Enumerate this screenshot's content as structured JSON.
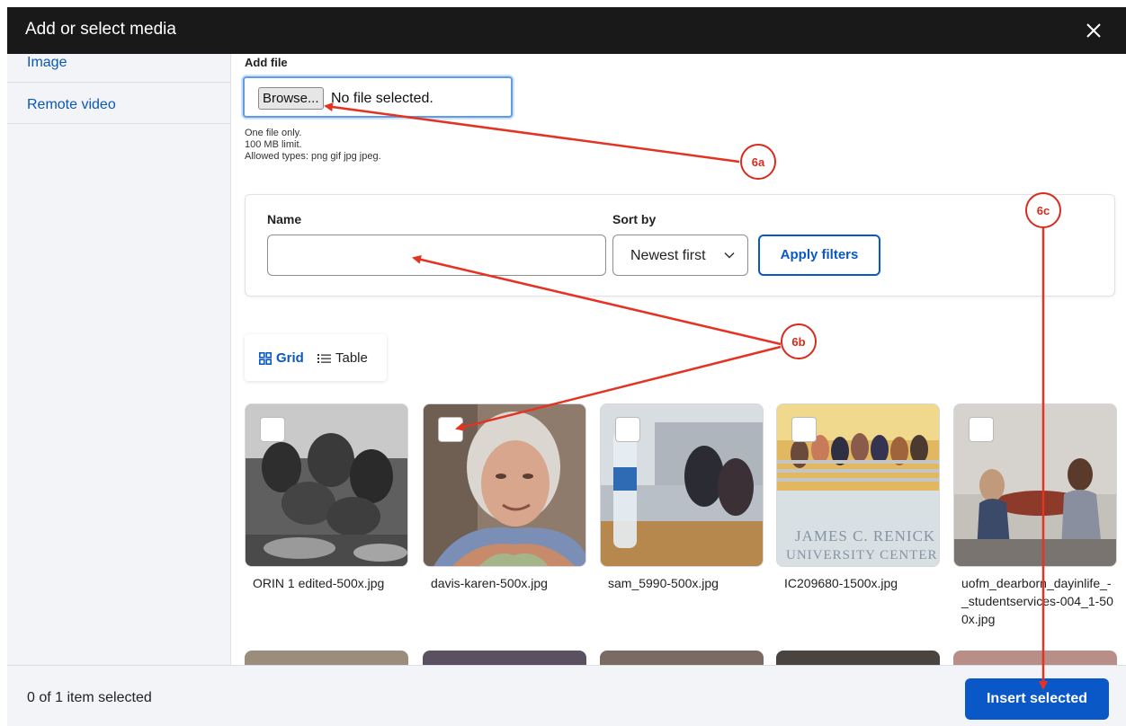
{
  "dialog": {
    "title": "Add or select media"
  },
  "sidebar": {
    "tabs": [
      {
        "label": "Image"
      },
      {
        "label": "Remote video"
      }
    ]
  },
  "upload": {
    "label": "Add file",
    "browse_label": "Browse...",
    "status": "No file selected.",
    "hints": [
      "One file only.",
      "100 MB limit.",
      "Allowed types: png gif jpg jpeg."
    ]
  },
  "filters": {
    "name_label": "Name",
    "name_value": "",
    "sort_label": "Sort by",
    "sort_value": "Newest first",
    "apply_label": "Apply filters"
  },
  "views": {
    "grid_label": "Grid",
    "table_label": "Table",
    "active": "grid"
  },
  "media": [
    {
      "filename": "ORIN 1 edited-500x.jpg"
    },
    {
      "filename": "davis-karen-500x.jpg"
    },
    {
      "filename": "sam_5990-500x.jpg"
    },
    {
      "filename": "IC209680-1500x.jpg",
      "sign_lines": [
        "JAMES C. RENICK",
        "UNIVERSITY CENTER"
      ]
    },
    {
      "filename": "uofm_dearborn_dayinlife_-_studentservices-004_1-500x.jpg"
    }
  ],
  "footer": {
    "selection_status": "0 of 1 item selected",
    "insert_label": "Insert selected"
  },
  "annotations": [
    "6a",
    "6b",
    "6c"
  ],
  "colors": {
    "accent": "#0a58c8",
    "annotation": "#d72b1c",
    "titlebar": "#191919"
  }
}
